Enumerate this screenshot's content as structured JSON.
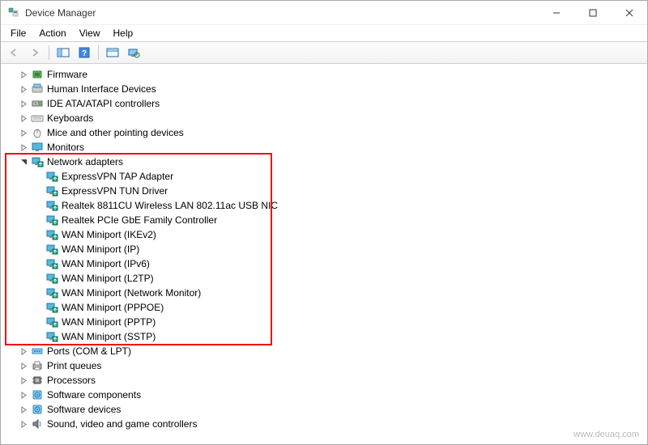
{
  "window": {
    "title": "Device Manager"
  },
  "menu": {
    "file": "File",
    "action": "Action",
    "view": "View",
    "help": "Help"
  },
  "tree": {
    "categories": [
      {
        "label": "Firmware",
        "icon": "firmware",
        "expanded": false
      },
      {
        "label": "Human Interface Devices",
        "icon": "hid",
        "expanded": false
      },
      {
        "label": "IDE ATA/ATAPI controllers",
        "icon": "ide",
        "expanded": false
      },
      {
        "label": "Keyboards",
        "icon": "keyboard",
        "expanded": false
      },
      {
        "label": "Mice and other pointing devices",
        "icon": "mouse",
        "expanded": false
      },
      {
        "label": "Monitors",
        "icon": "monitor",
        "expanded": false
      },
      {
        "label": "Network adapters",
        "icon": "network",
        "expanded": true,
        "highlighted": true,
        "children": [
          {
            "label": "ExpressVPN TAP Adapter",
            "icon": "network"
          },
          {
            "label": "ExpressVPN TUN Driver",
            "icon": "network"
          },
          {
            "label": "Realtek 8811CU Wireless LAN 802.11ac USB NIC",
            "icon": "network"
          },
          {
            "label": "Realtek PCIe GbE Family Controller",
            "icon": "network"
          },
          {
            "label": "WAN Miniport (IKEv2)",
            "icon": "network"
          },
          {
            "label": "WAN Miniport (IP)",
            "icon": "network"
          },
          {
            "label": "WAN Miniport (IPv6)",
            "icon": "network"
          },
          {
            "label": "WAN Miniport (L2TP)",
            "icon": "network"
          },
          {
            "label": "WAN Miniport (Network Monitor)",
            "icon": "network"
          },
          {
            "label": "WAN Miniport (PPPOE)",
            "icon": "network"
          },
          {
            "label": "WAN Miniport (PPTP)",
            "icon": "network"
          },
          {
            "label": "WAN Miniport (SSTP)",
            "icon": "network"
          }
        ]
      },
      {
        "label": "Ports (COM & LPT)",
        "icon": "ports",
        "expanded": false
      },
      {
        "label": "Print queues",
        "icon": "printer",
        "expanded": false
      },
      {
        "label": "Processors",
        "icon": "cpu",
        "expanded": false
      },
      {
        "label": "Software components",
        "icon": "software",
        "expanded": false
      },
      {
        "label": "Software devices",
        "icon": "software",
        "expanded": false
      },
      {
        "label": "Sound, video and game controllers",
        "icon": "sound",
        "expanded": false
      }
    ]
  },
  "watermark": "www.deuaq.com"
}
